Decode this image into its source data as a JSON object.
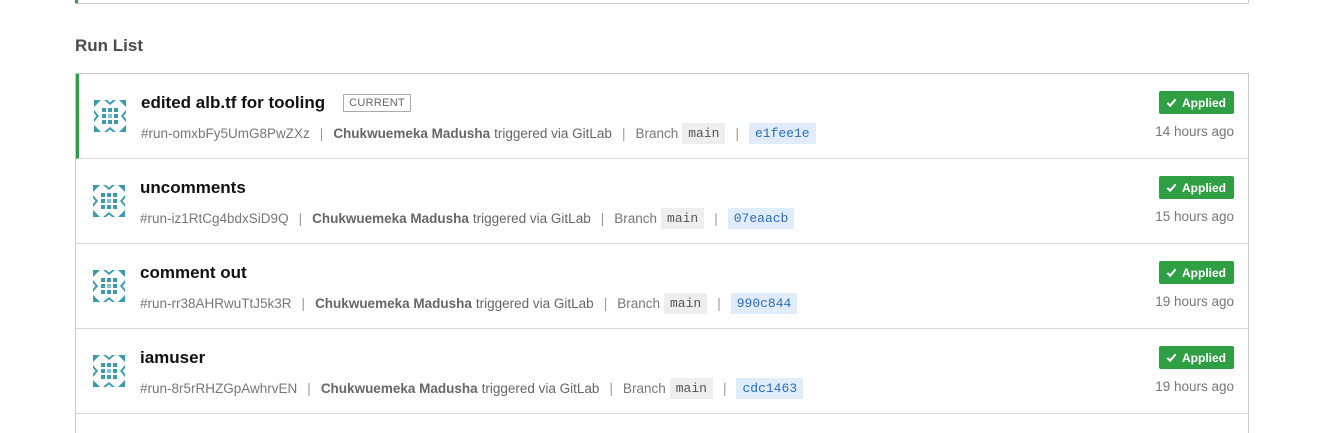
{
  "section_title": "Run List",
  "runs": [
    {
      "title": "edited alb.tf for tooling",
      "current": true,
      "current_label": "CURRENT",
      "run_id": "#run-omxbFy5UmG8PwZXz",
      "author": "Chukwuemeka Madusha",
      "trigger_text": "triggered via GitLab",
      "branch_label": "Branch",
      "branch": "main",
      "commit": "e1fee1e",
      "status": "Applied",
      "time": "14 hours ago"
    },
    {
      "title": "uncomments",
      "current": false,
      "current_label": "",
      "run_id": "#run-iz1RtCg4bdxSiD9Q",
      "author": "Chukwuemeka Madusha",
      "trigger_text": "triggered via GitLab",
      "branch_label": "Branch",
      "branch": "main",
      "commit": "07eaacb",
      "status": "Applied",
      "time": "15 hours ago"
    },
    {
      "title": "comment out",
      "current": false,
      "current_label": "",
      "run_id": "#run-rr38AHRwuTtJ5k3R",
      "author": "Chukwuemeka Madusha",
      "trigger_text": "triggered via GitLab",
      "branch_label": "Branch",
      "branch": "main",
      "commit": "990c844",
      "status": "Applied",
      "time": "19 hours ago"
    },
    {
      "title": "iamuser",
      "current": false,
      "current_label": "",
      "run_id": "#run-8r5rRHZGpAwhrvEN",
      "author": "Chukwuemeka Madusha",
      "trigger_text": "triggered via GitLab",
      "branch_label": "Branch",
      "branch": "main",
      "commit": "cdc1463",
      "status": "Applied",
      "time": "19 hours ago"
    }
  ],
  "colors": {
    "accent_green": "#2ea043",
    "sha_text": "#2a6ebb",
    "sha_bg": "#e1ecfb",
    "avatar_teal": "#3a9bb0"
  },
  "icons": {
    "avatar": "identicon-avatar",
    "status": "check-icon"
  }
}
